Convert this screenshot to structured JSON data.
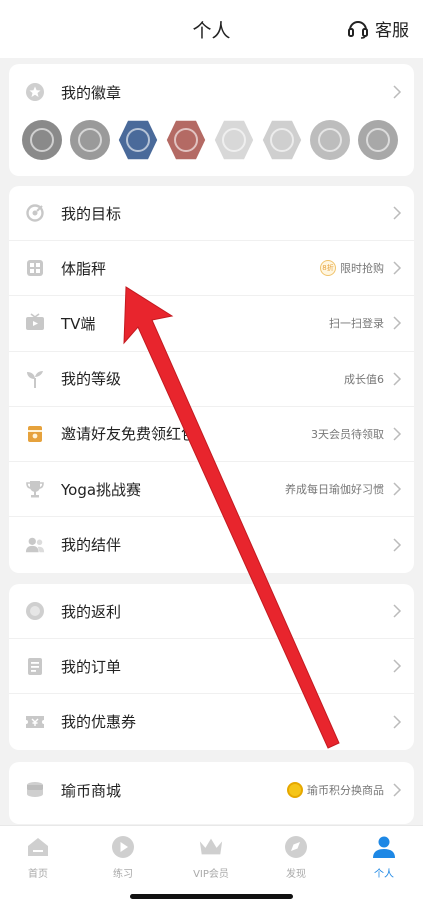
{
  "header": {
    "title": "个人",
    "service_label": "客服"
  },
  "badges": {
    "label": "我的徽章",
    "items": [
      {
        "name": "badge-1",
        "color": "#8a8a8a",
        "shape": "circle"
      },
      {
        "name": "badge-2",
        "color": "#9a9a9a",
        "shape": "circle"
      },
      {
        "name": "badge-3",
        "color": "#4a6a9a",
        "shape": "hex"
      },
      {
        "name": "badge-4",
        "color": "#b46a64",
        "shape": "hex"
      },
      {
        "name": "badge-5",
        "color": "#d8d8d8",
        "shape": "hex"
      },
      {
        "name": "badge-6",
        "color": "#cfcfcf",
        "shape": "hex"
      },
      {
        "name": "badge-7",
        "color": "#bdbdbd",
        "shape": "circle"
      },
      {
        "name": "badge-8",
        "color": "#a8a8a8",
        "shape": "circle"
      }
    ]
  },
  "main_list": [
    {
      "label": "我的目标",
      "right": "",
      "icon": "target-icon"
    },
    {
      "label": "体脂秤",
      "right": "限时抢购",
      "icon": "scale-icon",
      "right_icon": "8折"
    },
    {
      "label": "TV端",
      "right": "扫一扫登录",
      "icon": "tv-icon"
    },
    {
      "label": "我的等级",
      "right": "成长值6",
      "icon": "sprout-icon"
    },
    {
      "label": "邀请好友免费领红包",
      "right": "3天会员待领取",
      "icon": "gift-icon"
    },
    {
      "label": "Yoga挑战赛",
      "right": "养成每日瑜伽好习惯",
      "icon": "trophy-icon"
    },
    {
      "label": "我的结伴",
      "right": "",
      "icon": "partners-icon"
    }
  ],
  "rebate_list": [
    {
      "label": "我的返利",
      "icon": "rebate-icon"
    },
    {
      "label": "我的订单",
      "icon": "order-icon"
    },
    {
      "label": "我的优惠券",
      "icon": "coupon-icon"
    }
  ],
  "mall": {
    "label": "瑜币商城",
    "right": "瑜币积分换商品",
    "icon": "coins-icon"
  },
  "tabs": [
    {
      "label": "首页",
      "icon": "home-icon"
    },
    {
      "label": "练习",
      "icon": "play-icon"
    },
    {
      "label": "VIP会员",
      "icon": "crown-icon"
    },
    {
      "label": "发现",
      "icon": "compass-icon"
    },
    {
      "label": "个人",
      "icon": "user-icon",
      "active": true
    }
  ],
  "colors": {
    "accent": "#1e88e5",
    "arrow": "#e8252d",
    "icon_gray": "#c8c8c8",
    "gift_gold": "#e6a23c"
  }
}
